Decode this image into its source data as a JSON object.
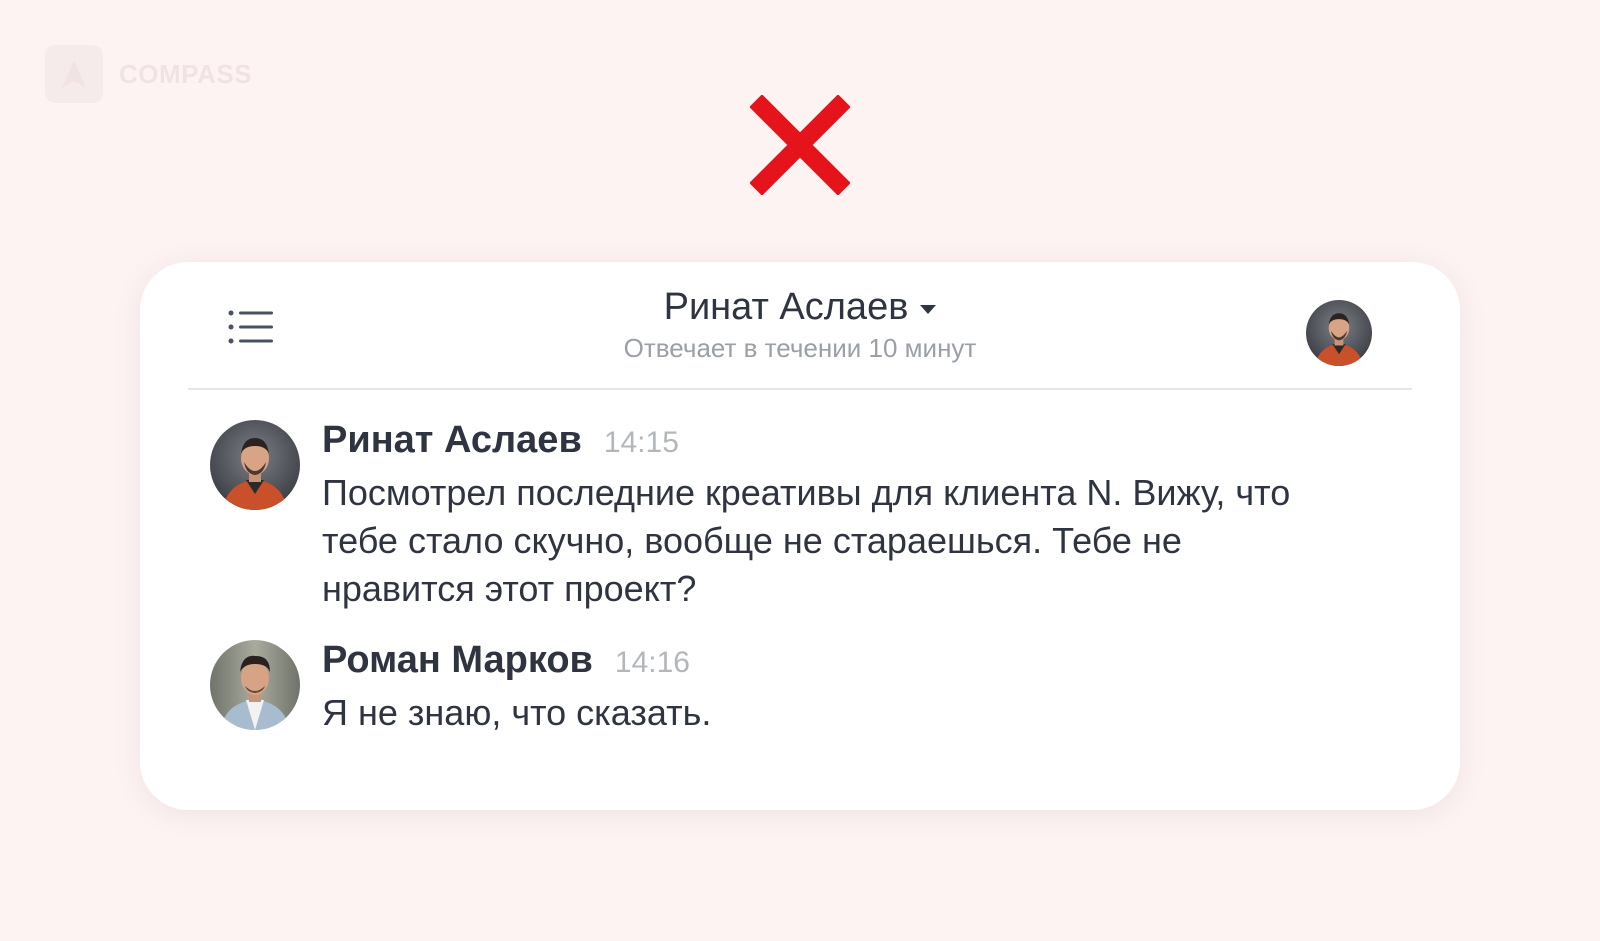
{
  "watermark": {
    "brand": "COMPASS"
  },
  "chat": {
    "header": {
      "name": "Ринат Аслаев",
      "status": "Отвечает в течении 10 минут"
    },
    "messages": [
      {
        "author": "Ринат Аслаев",
        "time": "14:15",
        "text": "Посмотрел последние креативы для клиента N. Вижу, что тебе стало скучно, вообще не стараешься. Тебе не нравится этот проект?"
      },
      {
        "author": "Роман Марков",
        "time": "14:16",
        "text": "Я не знаю, что сказать."
      }
    ]
  },
  "colors": {
    "background": "#fdf3f3",
    "cross": "#e5141b",
    "text_primary": "#2e3440",
    "text_secondary": "#9aa0a6"
  },
  "icons": {
    "cross": "cross-icon",
    "menu": "menu-icon",
    "dropdown": "caret-down-icon"
  }
}
